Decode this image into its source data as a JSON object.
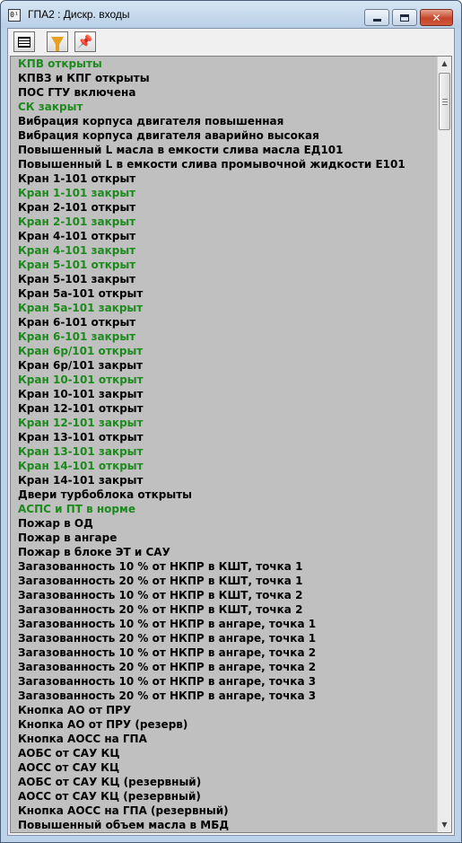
{
  "window": {
    "app_icon_text": "0¹",
    "title": "ГПА2 : Дискр. входы"
  },
  "colors": {
    "active_text": "#1c8a1c",
    "normal_text": "#000000",
    "list_background": "#c0c0c0"
  },
  "toolbar": {
    "buttons": [
      {
        "icon": "list-view-icon"
      },
      {
        "icon": "filter-icon"
      },
      {
        "icon": "pin-icon"
      }
    ]
  },
  "scrollbar": {
    "up_glyph": "▲",
    "down_glyph": "▼"
  },
  "items": [
    {
      "label": "КПВ открыты",
      "state": "green"
    },
    {
      "label": "КПВЗ и КПГ открыты",
      "state": "black"
    },
    {
      "label": "ПОС ГТУ включена",
      "state": "black"
    },
    {
      "label": "СК закрыт",
      "state": "green"
    },
    {
      "label": "Вибрация корпуса двигателя повышенная",
      "state": "black"
    },
    {
      "label": "Вибрация корпуса двигателя аварийно высокая",
      "state": "black"
    },
    {
      "label": "Повышенный L масла в емкости слива масла ЕД101",
      "state": "black"
    },
    {
      "label": "Повышенный L в емкости слива промывочной жидкости Е101",
      "state": "black"
    },
    {
      "label": "Кран 1-101 открыт",
      "state": "black"
    },
    {
      "label": "Кран 1-101 закрыт",
      "state": "green"
    },
    {
      "label": "Кран 2-101 открыт",
      "state": "black"
    },
    {
      "label": "Кран 2-101 закрыт",
      "state": "green"
    },
    {
      "label": "Кран 4-101 открыт",
      "state": "black"
    },
    {
      "label": "Кран 4-101 закрыт",
      "state": "green"
    },
    {
      "label": "Кран 5-101 открыт",
      "state": "green"
    },
    {
      "label": "Кран 5-101 закрыт",
      "state": "black"
    },
    {
      "label": "Кран 5а-101 открыт",
      "state": "black"
    },
    {
      "label": "Кран 5а-101 закрыт",
      "state": "green"
    },
    {
      "label": "Кран 6-101 открыт",
      "state": "black"
    },
    {
      "label": "Кран 6-101 закрыт",
      "state": "green"
    },
    {
      "label": "Кран 6р/101 открыт",
      "state": "green"
    },
    {
      "label": "Кран 6р/101 закрыт",
      "state": "black"
    },
    {
      "label": "Кран 10-101 открыт",
      "state": "green"
    },
    {
      "label": "Кран 10-101 закрыт",
      "state": "black"
    },
    {
      "label": "Кран 12-101 открыт",
      "state": "black"
    },
    {
      "label": "Кран 12-101 закрыт",
      "state": "green"
    },
    {
      "label": "Кран 13-101 открыт",
      "state": "black"
    },
    {
      "label": "Кран 13-101 закрыт",
      "state": "green"
    },
    {
      "label": "Кран 14-101 открыт",
      "state": "green"
    },
    {
      "label": "Кран 14-101 закрыт",
      "state": "black"
    },
    {
      "label": "Двери турбоблока открыты",
      "state": "black"
    },
    {
      "label": "АСПС и ПТ в норме",
      "state": "green"
    },
    {
      "label": "Пожар в ОД",
      "state": "black"
    },
    {
      "label": "Пожар в ангаре",
      "state": "black"
    },
    {
      "label": "Пожар в блоке ЭТ и САУ",
      "state": "black"
    },
    {
      "label": "Загазованность 10 % от НКПР в КШТ, точка 1",
      "state": "black"
    },
    {
      "label": "Загазованность 20 % от НКПР в КШТ, точка 1",
      "state": "black"
    },
    {
      "label": "Загазованность 10 % от НКПР в КШТ, точка 2",
      "state": "black"
    },
    {
      "label": "Загазованность 20 % от НКПР в КШТ, точка 2",
      "state": "black"
    },
    {
      "label": "Загазованность 10 % от НКПР в ангаре, точка 1",
      "state": "black"
    },
    {
      "label": "Загазованность 20 % от НКПР в ангаре, точка 1",
      "state": "black"
    },
    {
      "label": "Загазованность 10 % от НКПР в ангаре, точка 2",
      "state": "black"
    },
    {
      "label": "Загазованность 20 % от НКПР в ангаре, точка 2",
      "state": "black"
    },
    {
      "label": "Загазованность 10 % от НКПР в ангаре, точка 3",
      "state": "black"
    },
    {
      "label": "Загазованность 20 % от НКПР в ангаре, точка 3",
      "state": "black"
    },
    {
      "label": "Кнопка АО от ПРУ",
      "state": "black"
    },
    {
      "label": "Кнопка АО от ПРУ (резерв)",
      "state": "black"
    },
    {
      "label": "Кнопка АОСС на ГПА",
      "state": "black"
    },
    {
      "label": "АОБС от САУ КЦ",
      "state": "black"
    },
    {
      "label": "АОСС от САУ КЦ",
      "state": "black"
    },
    {
      "label": "АОБС от САУ КЦ (резервный)",
      "state": "black"
    },
    {
      "label": "АОСС от САУ КЦ (резервный)",
      "state": "black"
    },
    {
      "label": "Кнопка АОСС на ГПА (резервный)",
      "state": "black"
    },
    {
      "label": "Повышенный объем масла в МБД",
      "state": "black"
    }
  ]
}
